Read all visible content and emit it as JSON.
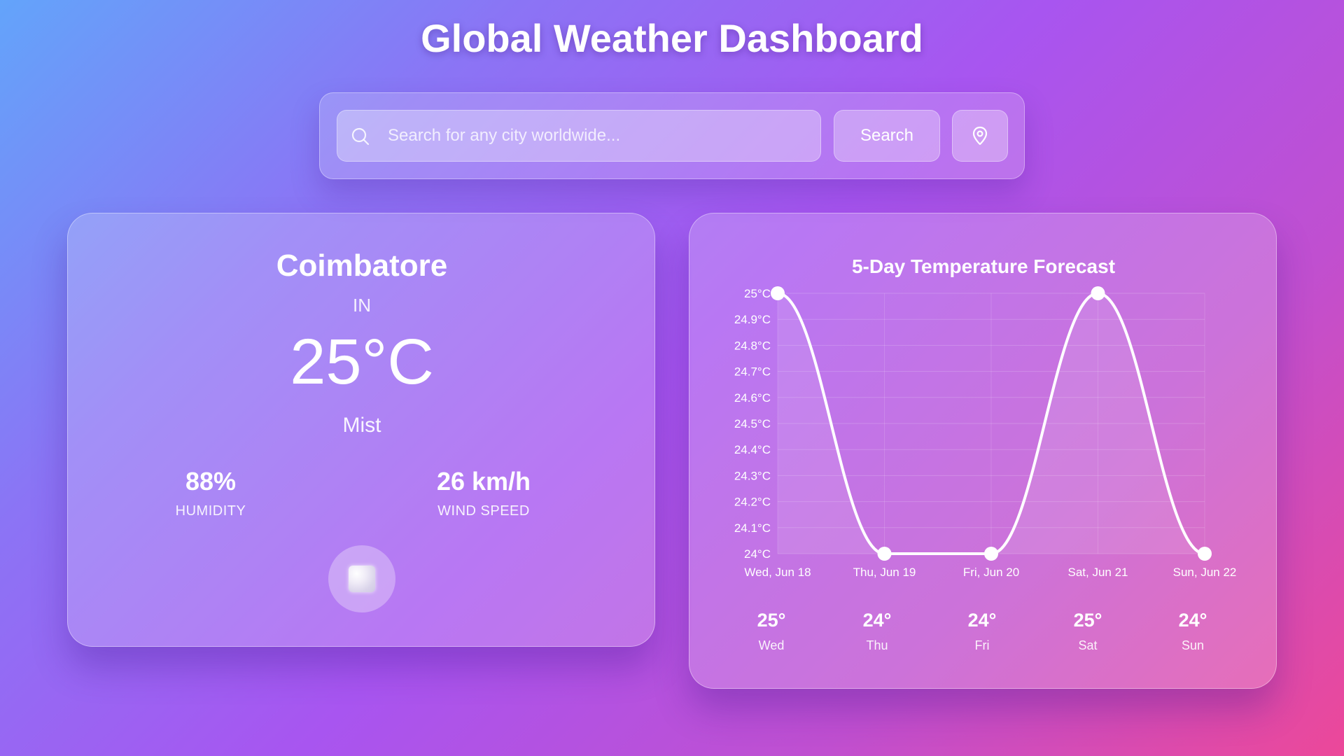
{
  "header": {
    "title": "Global Weather Dashboard"
  },
  "search": {
    "placeholder": "Search for any city worldwide...",
    "button_label": "Search",
    "search_icon": "search-icon",
    "location_icon": "location-pin-icon"
  },
  "current": {
    "city": "Coimbatore",
    "country": "IN",
    "temperature": "25°C",
    "description": "Mist",
    "humidity_value": "88%",
    "humidity_label": "HUMIDITY",
    "wind_value": "26 km/h",
    "wind_label": "WIND SPEED",
    "icon": "mist-icon"
  },
  "forecast": {
    "days": [
      {
        "temp": "25°",
        "day": "Wed"
      },
      {
        "temp": "24°",
        "day": "Thu"
      },
      {
        "temp": "24°",
        "day": "Fri"
      },
      {
        "temp": "25°",
        "day": "Sat"
      },
      {
        "temp": "24°",
        "day": "Sun"
      }
    ]
  },
  "chart_data": {
    "type": "line",
    "title": "5-Day Temperature Forecast",
    "categories": [
      "Wed, Jun 18",
      "Thu, Jun 19",
      "Fri, Jun 20",
      "Sat, Jun 21",
      "Sun, Jun 22"
    ],
    "series": [
      {
        "values": [
          25,
          24,
          24,
          25,
          24
        ]
      }
    ],
    "ylim": [
      24,
      25
    ],
    "yticks": [
      "24°C",
      "24.1°C",
      "24.2°C",
      "24.3°C",
      "24.4°C",
      "24.5°C",
      "24.6°C",
      "24.7°C",
      "24.8°C",
      "24.9°C",
      "25°C"
    ],
    "xlabel": "",
    "ylabel": "",
    "grid": true,
    "line_color": "#ffffff"
  }
}
